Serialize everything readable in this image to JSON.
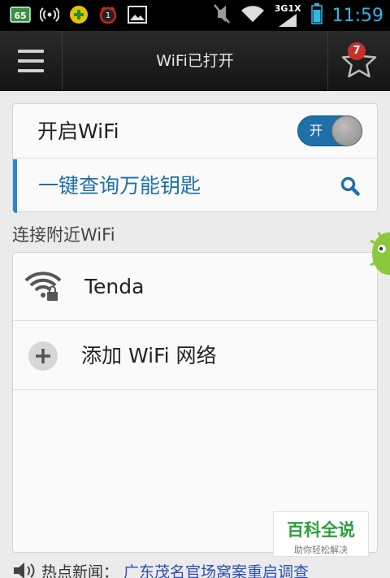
{
  "status_bar": {
    "network_label": "3G1X",
    "time": "11:59",
    "alarm_count": "1",
    "time_color": "#33b5e5"
  },
  "header": {
    "title": "WiFi已打开",
    "favorites_badge": "7"
  },
  "wifi_toggle": {
    "label": "开启WiFi",
    "state_label": "开",
    "on": true
  },
  "key_query": {
    "label": "一键查询万能钥匙"
  },
  "nearby": {
    "section_title": "连接附近WiFi",
    "networks": [
      {
        "ssid": "Tenda",
        "locked": true
      }
    ],
    "add_label": "添加 WiFi 网络"
  },
  "news": {
    "label": "热点新闻：",
    "headline": "广东茂名官场窝案重启调查"
  },
  "watermark": {
    "title": "百科全说",
    "subtitle": "助你轻松解决"
  },
  "colors": {
    "accent": "#2b85c7",
    "header_bg": "#1c1c1c",
    "badge": "#c8302c"
  }
}
